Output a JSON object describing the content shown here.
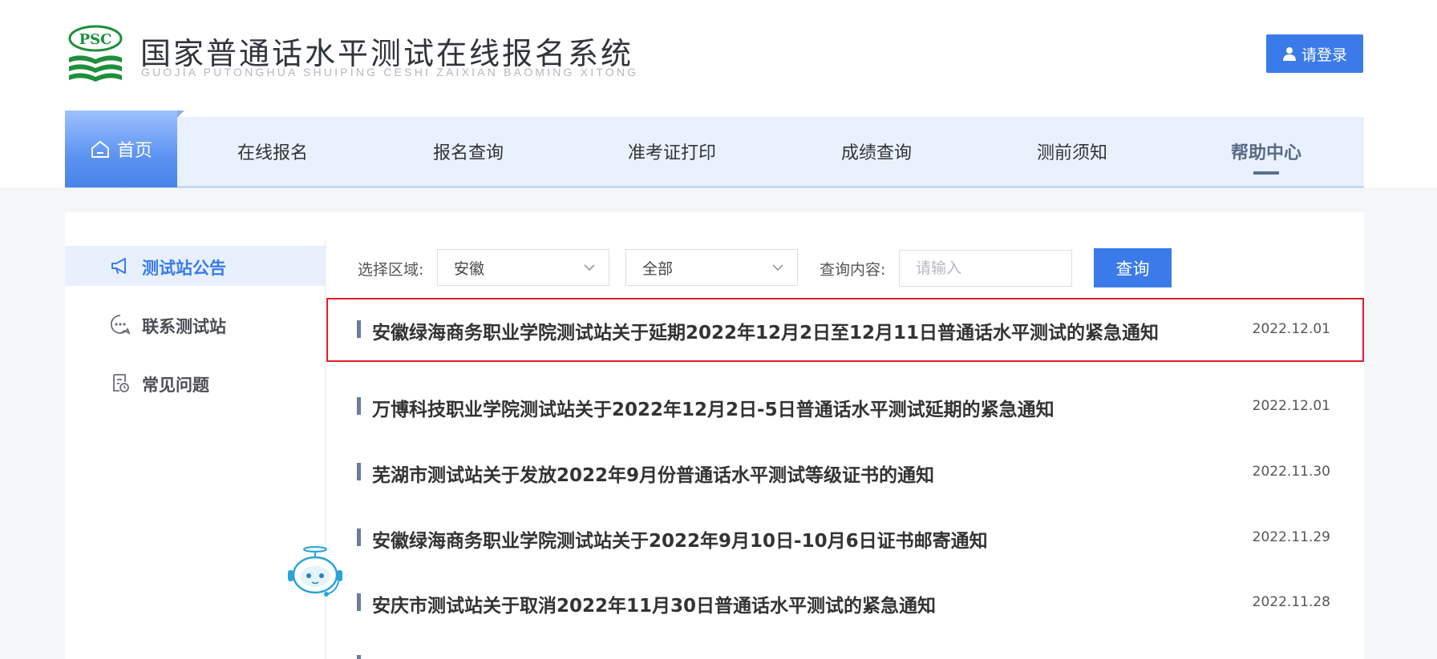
{
  "header": {
    "logo_text": "PSC",
    "title": "国家普通话水平测试在线报名系统",
    "subtitle": "GUOJIA PUTONGHUA SHUIPING CESHI ZAIXIAN BAOMING XITONG",
    "login_label": "请登录"
  },
  "nav": {
    "home": "首页",
    "items": [
      "在线报名",
      "报名查询",
      "准考证打印",
      "成绩查询",
      "测前须知",
      "帮助中心"
    ],
    "active": "帮助中心"
  },
  "sidebar": {
    "items": [
      {
        "label": "测试站公告",
        "icon": "megaphone-icon",
        "active": true
      },
      {
        "label": "联系测试站",
        "icon": "chat-bubble-icon",
        "active": false
      },
      {
        "label": "常见问题",
        "icon": "document-clock-icon",
        "active": false
      }
    ]
  },
  "filters": {
    "region_label": "选择区域:",
    "region_value": "安徽",
    "scope_value": "全部",
    "query_label": "查询内容:",
    "query_placeholder": "请输入",
    "query_button": "查询"
  },
  "notices": [
    {
      "title": "安徽绿海商务职业学院测试站关于延期2022年12月2日至12月11日普通话水平测试的紧急通知",
      "date": "2022.12.01",
      "highlighted": true
    },
    {
      "title": "万博科技职业学院测试站关于2022年12月2日-5日普通话水平测试延期的紧急通知",
      "date": "2022.12.01",
      "highlighted": false
    },
    {
      "title": "芜湖市测试站关于发放2022年9月份普通话水平测试等级证书的通知",
      "date": "2022.11.30",
      "highlighted": false
    },
    {
      "title": "安徽绿海商务职业学院测试站关于2022年9月10日-10月6日证书邮寄通知",
      "date": "2022.11.29",
      "highlighted": false
    },
    {
      "title": "安庆市测试站关于取消2022年11月30日普通话水平测试的紧急通知",
      "date": "2022.11.28",
      "highlighted": false
    }
  ],
  "colors": {
    "accent": "#3a7be9",
    "highlight_border": "#e31d27",
    "logo_green": "#1f8e3a",
    "nav_bg": "#e9f1fd"
  }
}
